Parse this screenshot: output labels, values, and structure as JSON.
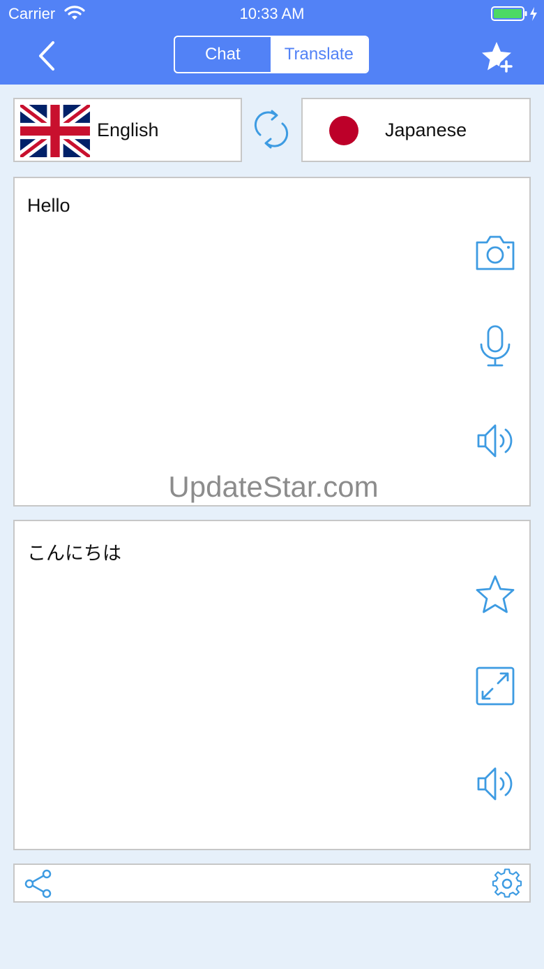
{
  "status_bar": {
    "carrier": "Carrier",
    "time": "10:33 AM"
  },
  "header": {
    "tabs": [
      {
        "label": "Chat",
        "selected": false
      },
      {
        "label": "Translate",
        "selected": true
      }
    ],
    "accent_color": "#5282f6"
  },
  "languages": {
    "source": {
      "label": "English",
      "flag": "uk-flag-icon"
    },
    "target": {
      "label": "Japanese",
      "flag": "japan-flag-icon"
    }
  },
  "source_panel": {
    "text": "Hello",
    "watermark": "UpdateStar.com"
  },
  "result_panel": {
    "text": "こんにちは"
  },
  "icons": {
    "back": "chevron-left-icon",
    "favorite_add": "star-plus-icon",
    "swap": "swap-icon",
    "camera": "camera-icon",
    "microphone": "microphone-icon",
    "speaker": "speaker-icon",
    "star": "star-icon",
    "expand": "expand-icon",
    "share": "share-icon",
    "settings": "gear-icon"
  }
}
